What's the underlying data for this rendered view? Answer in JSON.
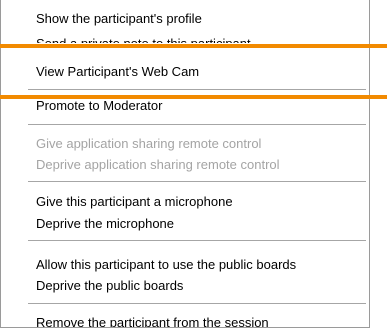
{
  "menu": {
    "group_profile": [
      {
        "label": "Show the participant's profile",
        "enabled": true
      },
      {
        "label": "Send a private note to this participant",
        "enabled": true
      }
    ],
    "webcam_item": {
      "label": "View Participant's Web Cam",
      "enabled": true
    },
    "promote_item": {
      "label": "Promote to Moderator",
      "enabled": true
    },
    "group_app_sharing": [
      {
        "label": "Give application sharing remote control",
        "enabled": false
      },
      {
        "label": "Deprive application sharing remote control",
        "enabled": false
      }
    ],
    "group_microphone": [
      {
        "label": "Give this participant a microphone",
        "enabled": true
      },
      {
        "label": "Deprive the microphone",
        "enabled": true
      }
    ],
    "group_boards": [
      {
        "label": "Allow this participant to use the public boards",
        "enabled": true
      },
      {
        "label": "Deprive the public boards",
        "enabled": true
      }
    ],
    "remove_item": {
      "label": "Remove the participant from the session",
      "enabled": true
    }
  },
  "colors": {
    "highlight": "#f28a00",
    "disabled_text": "#a4a4a4",
    "separator": "#a6a6a6"
  }
}
